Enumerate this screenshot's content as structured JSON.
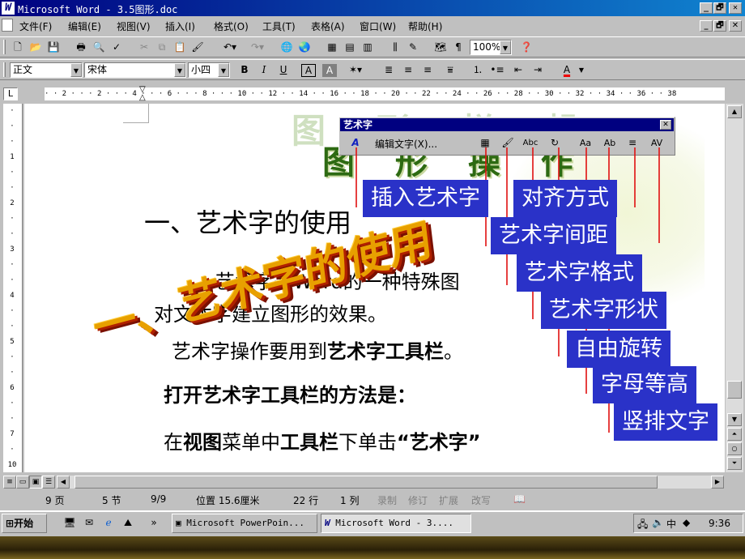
{
  "window": {
    "title": "Microsoft Word - 3.5图形.doc",
    "logo": "W",
    "min": "_",
    "max": "🗗",
    "close": "✕"
  },
  "menu": [
    "文件(F)",
    "编辑(E)",
    "视图(V)",
    "插入(I)",
    "格式(O)",
    "工具(T)",
    "表格(A)",
    "窗口(W)",
    "帮助(H)"
  ],
  "toolbar": {
    "zoom": "100%",
    "style": "正文",
    "font": "宋体",
    "size": "小四",
    "bold": "B",
    "italic": "I",
    "underline": "U",
    "border_a": "A",
    "shade_a": "A",
    "font_color_a": "A"
  },
  "ruler": {
    "ticks": "· · 2 · · · 2 · · · 4 · · · 6 · · · 8 · · · 10 · · 12 · · 14 · · 16 · · 18 · · 20 · · 22 · · 24 · · 26 · · 28 · · 30 · · 32 · · 34 · · 36 · · 38"
  },
  "document": {
    "heading_faded": "图 形 操 作",
    "heading_faded_top": "图 形 栏 帆",
    "section_title": "一、艺术字的使用",
    "wordart": "一、艺术字的使用",
    "para1_part1": "艺术字是Word的一种特殊图",
    "para1_part2": "对文本字建立图形的效果。",
    "para2_prefix": "艺术字操作要用到",
    "para2_bold": "艺术字工具栏",
    "para2_suffix": "。",
    "para3": "打开艺术字工具栏的方法是：",
    "para4_prefix": "在",
    "para4_b1": "视图",
    "para4_mid": "菜单中",
    "para4_b2": "工具栏",
    "para4_mid2": "下单击",
    "para4_q": "“艺术字”"
  },
  "wordart_toolbar": {
    "title": "艺术字",
    "close": "✕",
    "edit_text": "编辑文字(X)..."
  },
  "callouts": {
    "insert": "插入艺术字",
    "align": "对齐方式",
    "spacing": "艺术字间距",
    "format": "艺术字格式",
    "shape": "艺术字形状",
    "rotate": "自由旋转",
    "same_height": "字母等高",
    "vertical": "竖排文字"
  },
  "status": {
    "page": "9 页",
    "section": "5 节",
    "pages": "9/9",
    "position": "位置 15.6厘米",
    "line": "22 行",
    "column": "1 列",
    "rec": "录制",
    "trk": "修订",
    "ext": "扩展",
    "ovr": "改写"
  },
  "taskbar": {
    "start": "开始",
    "task1": "Microsoft PowerPoin...",
    "task2": "Microsoft Word - 3....",
    "time": "9:36",
    "more": "»"
  }
}
